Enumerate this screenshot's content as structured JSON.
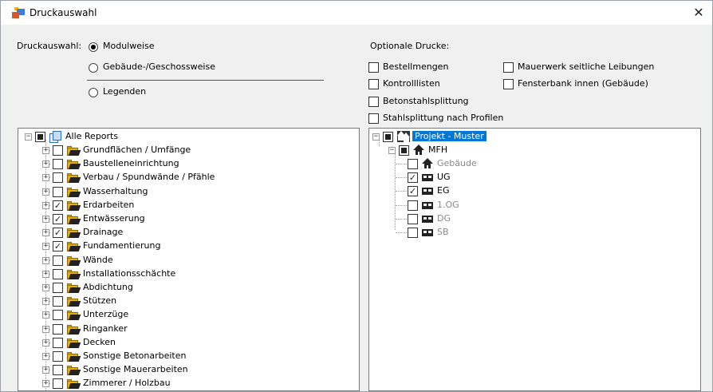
{
  "window": {
    "title": "Druckauswahl",
    "close_glyph": "✕"
  },
  "print_selection": {
    "label": "Druckauswahl:",
    "options": [
      {
        "label": "Modulweise",
        "selected": true
      },
      {
        "label": "Gebäude-/Geschossweise",
        "selected": false
      },
      {
        "label": "Legenden",
        "selected": false
      }
    ]
  },
  "optional_prints": {
    "label": "Optionale Drucke:",
    "items": [
      {
        "label": "Bestellmengen",
        "checked": false
      },
      {
        "label": "Kontrolllisten",
        "checked": false
      },
      {
        "label": "Betonstahlsplittung",
        "checked": false
      },
      {
        "label": "Stahlsplittung nach Profilen",
        "checked": false
      },
      {
        "label": "Mauerwerk seitliche Leibungen",
        "checked": false
      },
      {
        "label": "Fensterbank innen (Gebäude)",
        "checked": false
      }
    ]
  },
  "reports_tree": {
    "root": {
      "label": "Alle Reports",
      "state": "partial",
      "expander": "−"
    },
    "items": [
      {
        "label": "Grundflächen / Umfänge",
        "checked": false
      },
      {
        "label": "Baustelleneinrichtung",
        "checked": false
      },
      {
        "label": "Verbau / Spundwände / Pfähle",
        "checked": false
      },
      {
        "label": "Wasserhaltung",
        "checked": false
      },
      {
        "label": "Erdarbeiten",
        "checked": true
      },
      {
        "label": "Entwässerung",
        "checked": true
      },
      {
        "label": "Drainage",
        "checked": true
      },
      {
        "label": "Fundamentierung",
        "checked": true
      },
      {
        "label": "Wände",
        "checked": false
      },
      {
        "label": "Installationsschächte",
        "checked": false
      },
      {
        "label": "Abdichtung",
        "checked": false
      },
      {
        "label": "Stützen",
        "checked": false
      },
      {
        "label": "Unterzüge",
        "checked": false
      },
      {
        "label": "Ringanker",
        "checked": false
      },
      {
        "label": "Decken",
        "checked": false
      },
      {
        "label": "Sonstige Betonarbeiten",
        "checked": false
      },
      {
        "label": "Sonstige Mauerarbeiten",
        "checked": false
      },
      {
        "label": "Zimmerer / Holzbau",
        "checked": false
      }
    ]
  },
  "building_tree": {
    "project": {
      "label": "Projekt - Muster",
      "state": "partial",
      "selected": true
    },
    "building": {
      "label": "MFH",
      "state": "partial"
    },
    "items": [
      {
        "label": "Gebäude",
        "checked": false,
        "enabled": false,
        "icon": "house-icon"
      },
      {
        "label": "UG",
        "checked": true,
        "enabled": true,
        "icon": "floor-icon"
      },
      {
        "label": "EG",
        "checked": true,
        "enabled": true,
        "icon": "floor-icon"
      },
      {
        "label": "1.OG",
        "checked": false,
        "enabled": false,
        "icon": "floor-icon"
      },
      {
        "label": "DG",
        "checked": false,
        "enabled": false,
        "icon": "floor-icon"
      },
      {
        "label": "SB",
        "checked": false,
        "enabled": false,
        "icon": "floor-icon"
      }
    ]
  },
  "glyphs": {
    "check": "✓",
    "expand": "+",
    "collapse": "−"
  },
  "colors": {
    "selection": "#0078d7",
    "disabled_text": "#8a8a8a",
    "folder": "#e8b100"
  }
}
